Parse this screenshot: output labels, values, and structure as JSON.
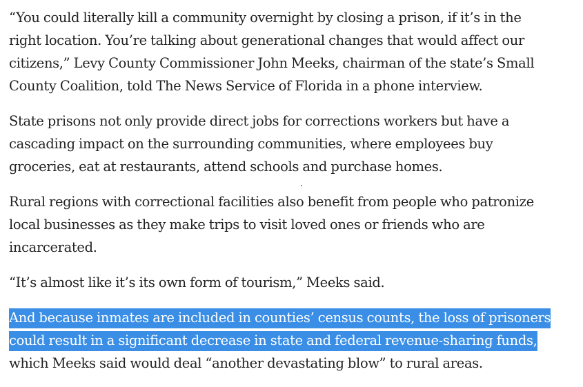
{
  "paragraphs": [
    {
      "lines": [
        "“You could literally kill a community overnight by closing a prison, if it’s in the",
        "right location. You’re talking about generational changes that would affect our",
        "citizens,” Levy County Commissioner John Meeks, chairman of the state’s Small",
        "County Coalition, told The News Service of Florida in a phone interview."
      ]
    },
    {
      "lines": [
        "State prisons not only provide direct jobs for corrections workers but have a",
        "cascading impact on the surrounding communities, where employees buy",
        "groceries, eat at restaurants, attend schools and purchase homes."
      ]
    },
    {
      "lines": [
        "Rural regions with correctional facilities also benefit from people who patronize",
        "local businesses as they make trips to visit loved ones or friends who are",
        "incarcerated."
      ]
    },
    {
      "lines": [
        "“It’s almost like it’s its own form of tourism,” Meeks said."
      ]
    },
    {
      "highlighted_lines": [
        "And because inmates are included in counties’ census counts, the loss of prisoners",
        "could result in a significant decrease in state and federal revenue-sharing funds,"
      ],
      "lines": [
        "which Meeks said would deal “another devastating blow” to rural areas."
      ]
    }
  ],
  "colors": {
    "text": "#222222",
    "selection_background": "#3a8ee6",
    "selection_text": "#ffffff"
  }
}
